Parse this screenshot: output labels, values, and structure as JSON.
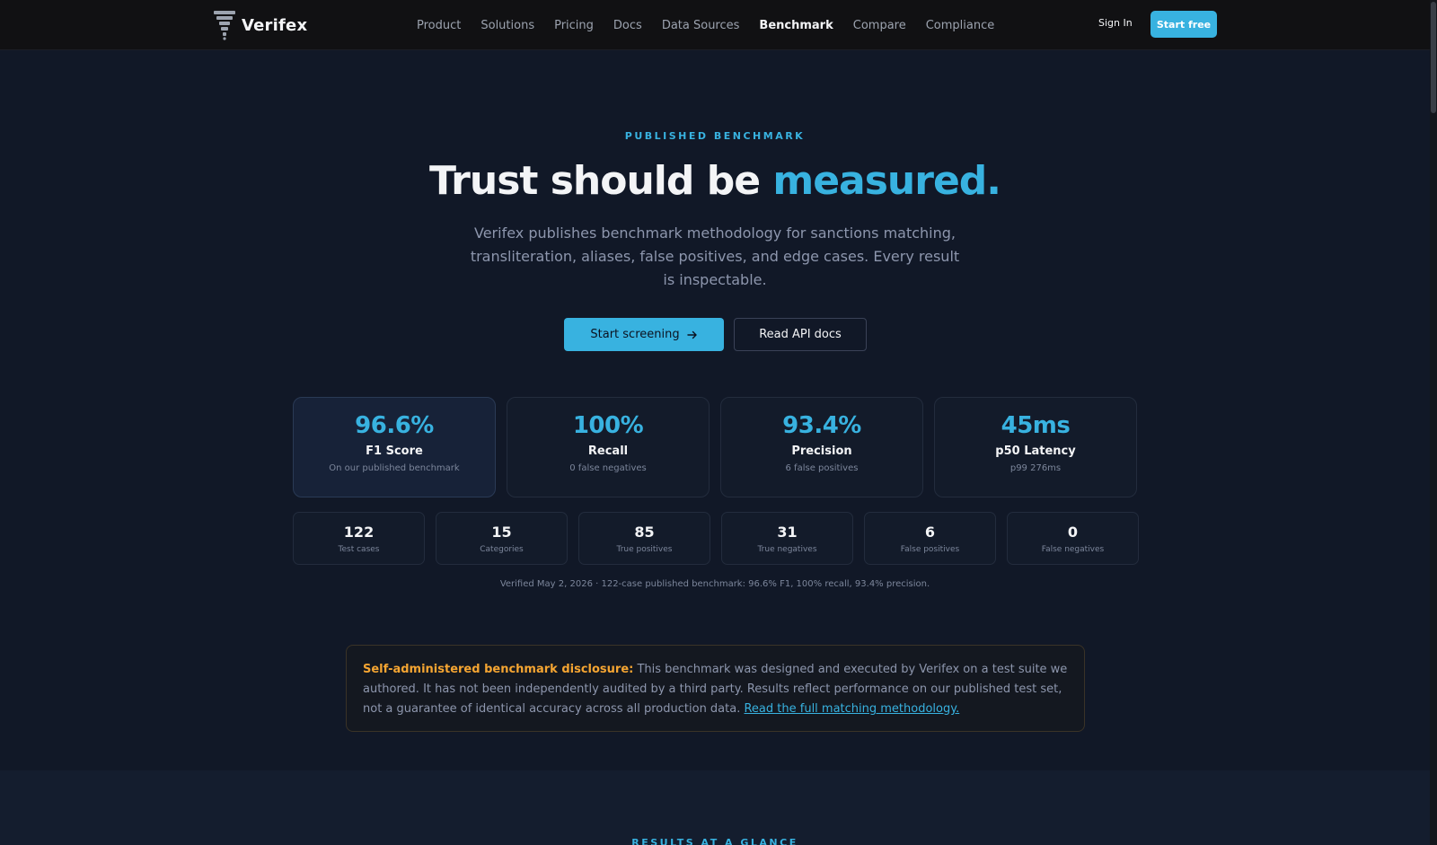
{
  "nav": {
    "brand": "Verifex",
    "links": [
      {
        "label": "Product"
      },
      {
        "label": "Solutions"
      },
      {
        "label": "Pricing"
      },
      {
        "label": "Docs"
      },
      {
        "label": "Data Sources"
      },
      {
        "label": "Benchmark"
      },
      {
        "label": "Compare"
      },
      {
        "label": "Compliance"
      }
    ],
    "active": "Benchmark",
    "signin": "Sign In",
    "cta": "Start free"
  },
  "hero": {
    "eyebrow": "PUBLISHED BENCHMARK",
    "title_main": "Trust should be ",
    "title_accent": "measured.",
    "subtitle": "Verifex publishes benchmark methodology for sanctions matching, transliteration, aliases, false positives, and edge cases. Every result is inspectable.",
    "primary_button": "Start screening",
    "primary_icon": "arrow-right-icon",
    "secondary_button": "Read API docs"
  },
  "metrics": [
    {
      "value": "96.6%",
      "label": "F1 Score",
      "sub": "On our published benchmark"
    },
    {
      "value": "100%",
      "label": "Recall",
      "sub": "0 false negatives"
    },
    {
      "value": "93.4%",
      "label": "Precision",
      "sub": "6 false positives"
    },
    {
      "value": "45ms",
      "label": "p50 Latency",
      "sub": "p99 276ms"
    }
  ],
  "stats": [
    {
      "value": "122",
      "label": "Test cases"
    },
    {
      "value": "15",
      "label": "Categories"
    },
    {
      "value": "85",
      "label": "True positives"
    },
    {
      "value": "31",
      "label": "True negatives"
    },
    {
      "value": "6",
      "label": "False positives"
    },
    {
      "value": "0",
      "label": "False negatives"
    }
  ],
  "verified_note": "Verified May 2, 2026 · 122-case published benchmark: 96.6% F1, 100% recall, 93.4% precision.",
  "disclosure": {
    "title": "Self-administered benchmark disclosure:",
    "body": " This benchmark was designed and executed by Verifex on a test suite we authored. It has not been independently audited by a third party. Results reflect performance on our published test set, not a guarantee of identical accuracy across all production data. ",
    "link": "Read the full matching methodology."
  },
  "next_section": {
    "eyebrow": "RESULTS AT A GLANCE"
  },
  "colors": {
    "accent": "#38b2e0",
    "warning": "#f5a532",
    "background": "#111827"
  }
}
